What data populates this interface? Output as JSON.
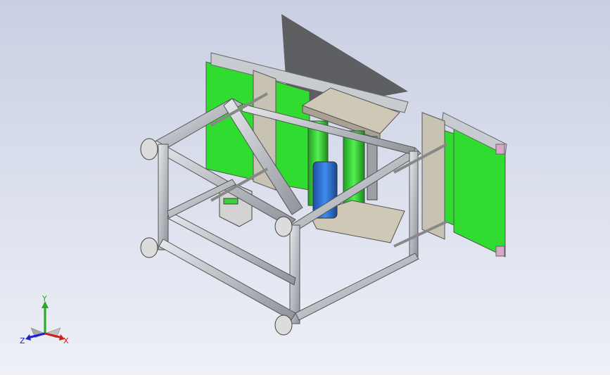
{
  "viewport": {
    "background_top": "#c9cfe3",
    "background_bottom": "#eef0f6"
  },
  "model": {
    "frame_color": "#b9bcc2",
    "panel_color": "#2fdc2f",
    "plate_color": "#c8c2b4",
    "motor_color": "#2a6fd6",
    "end_cap_color": "#d7a7c9"
  },
  "triad": {
    "x_label": "X",
    "y_label": "Y",
    "z_label": "Z",
    "x_color": "#d02020",
    "y_color": "#22aa22",
    "z_color": "#2020cc"
  }
}
